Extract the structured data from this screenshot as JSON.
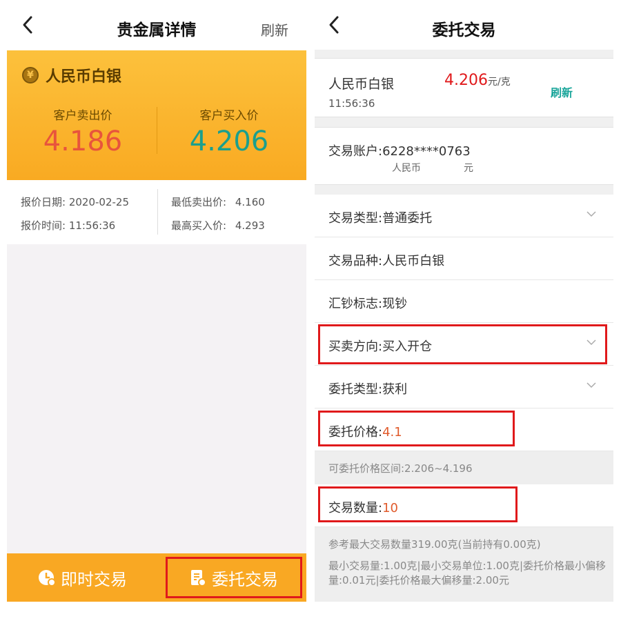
{
  "left": {
    "title": "贵金属详情",
    "refresh": "刷新",
    "metal_name": "人民币白银",
    "sell_label": "客户卖出价",
    "sell_price": "4.186",
    "buy_label": "客户买入价",
    "buy_price": "4.206",
    "quote_date_label": "报价日期:",
    "quote_date": "2020-02-25",
    "quote_time_label": "报价时间:",
    "quote_time": "11:56:36",
    "min_sell_label": "最低卖出价:",
    "min_sell": "4.160",
    "max_buy_label": "最高买入价:",
    "max_buy": "4.293",
    "instant_trade": "即时交易",
    "entrust_trade": "委托交易"
  },
  "right": {
    "title": "委托交易",
    "product": "人民币白银",
    "price": "4.206",
    "price_unit": "元/克",
    "time": "11:56:36",
    "refresh": "刷新",
    "account_label": "交易账户:",
    "account_no": "6228****0763",
    "account_currency": "人民币",
    "account_balance_suffix": "元",
    "rows": [
      {
        "label": "交易类型:",
        "value": "普通委托"
      },
      {
        "label": "交易品种:",
        "value": "人民币白银"
      },
      {
        "label": "汇钞标志:",
        "value": "现钞"
      },
      {
        "label": "买卖方向:",
        "value": "买入开仓"
      },
      {
        "label": "委托类型:",
        "value": "获利"
      },
      {
        "label": "委托价格:",
        "value": "4.1"
      },
      {
        "label": "交易数量:",
        "value": "10"
      }
    ],
    "price_range_hint": "可委托价格区间:2.206~4.196",
    "max_qty_hint": "参考最大交易数量319.00克(当前持有0.00克)",
    "rules_hint": "最小交易量:1.00克|最小交易单位:1.00克|委托价格最小偏移量:0.01元|委托价格最大偏移量:2.00元"
  },
  "colors": {
    "orange": "#f9a823",
    "sell_red": "#e8543c",
    "buy_green": "#1b9f8d",
    "highlight_red": "#e0191b",
    "refresh_teal": "#19a59a"
  }
}
